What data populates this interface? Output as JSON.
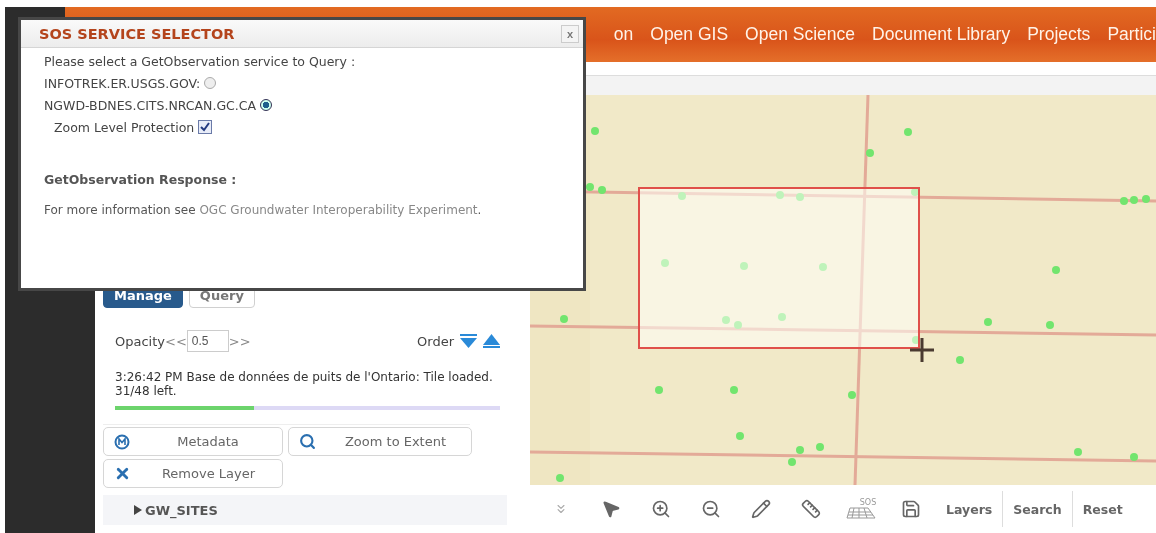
{
  "header": {
    "nav": [
      "on",
      "Open GIS",
      "Open Science",
      "Document Library",
      "Projects",
      "Partici"
    ]
  },
  "dialog": {
    "title": "SOS SERVICE SELECTOR",
    "close": "x",
    "prompt": "Please select a GetObservation service to Query :",
    "services": [
      {
        "label": "INFOTREK.ER.USGS.GOV:",
        "selected": false
      },
      {
        "label": "NGWD-BDNES.CITS.NRCAN.GC.CA",
        "selected": true
      }
    ],
    "zoom_protection": {
      "label": "Zoom Level Protection",
      "checked": true
    },
    "response_heading": "GetObservation Response :",
    "info": "For more information see",
    "link": "OGC Groundwater Interoperability Experiment",
    "info_end": "."
  },
  "panel": {
    "tabs": [
      {
        "label": "Manage",
        "selected": true
      },
      {
        "label": "Query",
        "selected": false
      }
    ],
    "opacity": {
      "label": "Opacity",
      "decrease": "<<",
      "value": "0.5",
      "increase": ">>"
    },
    "order_label": "Order",
    "status": "3:26:42 PM Base de données de puits de l'Ontario: Tile loaded. 31/48 left.",
    "progress": {
      "level": 0.36
    },
    "actions": [
      {
        "kind": "metadata",
        "label": "Metadata"
      },
      {
        "kind": "zoom",
        "label": "Zoom to Extent"
      },
      {
        "kind": "remove",
        "label": "Remove Layer"
      }
    ],
    "layers": [
      {
        "label": "GW_SITES",
        "expanded": false
      }
    ]
  },
  "toolbar": {
    "tools": [
      {
        "kind": "collapse"
      },
      {
        "kind": "pointer"
      },
      {
        "kind": "zoom-in"
      },
      {
        "kind": "zoom-out"
      },
      {
        "kind": "pencil"
      },
      {
        "kind": "ruler"
      },
      {
        "kind": "sos",
        "label": "SOS"
      },
      {
        "kind": "save"
      }
    ],
    "buttons": [
      "Layers",
      "Search",
      "Reset"
    ]
  }
}
